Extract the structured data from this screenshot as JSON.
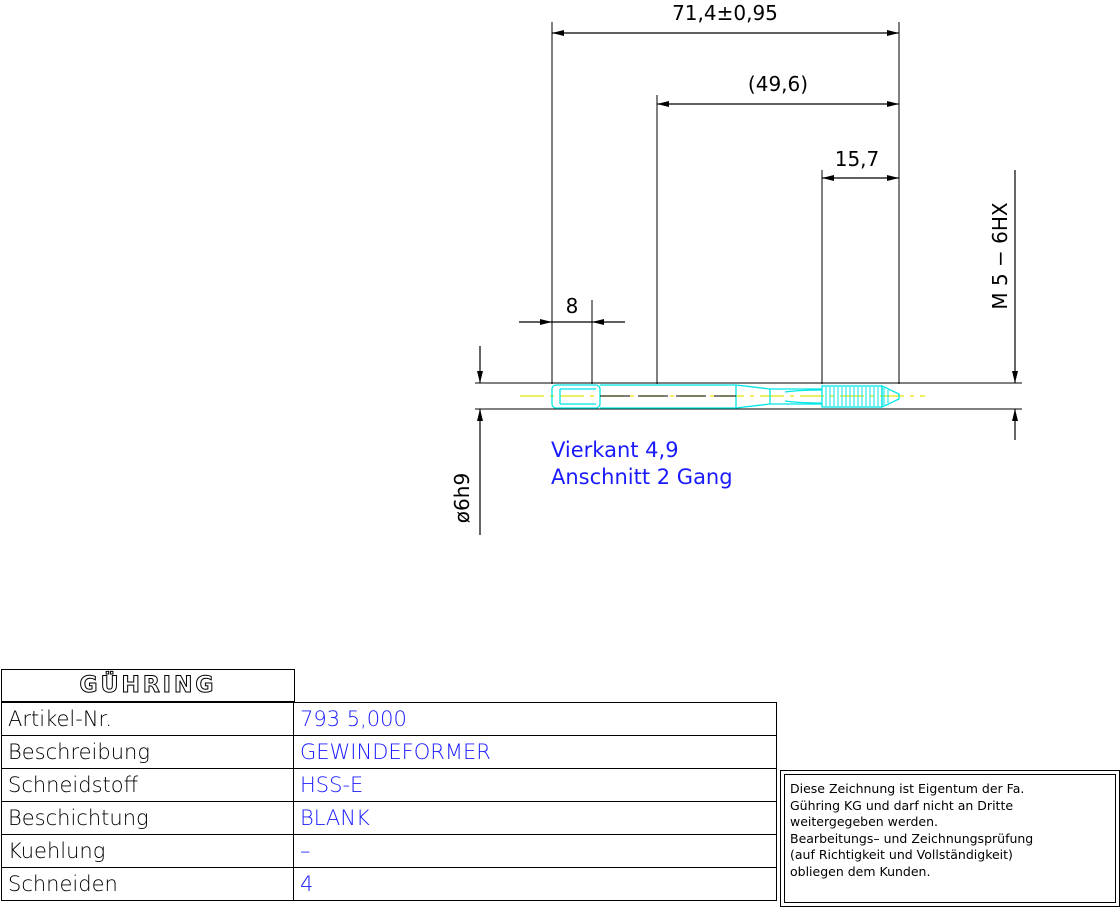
{
  "dimensions": {
    "overall_length": "71,4±0,95",
    "shank_length": "(49,6)",
    "thread_length": "15,7",
    "square_length": "8",
    "thread_spec": "M 5 − 6HX",
    "shank_diameter": "ø6h9"
  },
  "annotations": {
    "line1": "Vierkant 4,9",
    "line2": "Anschnitt 2 Gang"
  },
  "title_block": {
    "logo": "GÜHRING",
    "rows": [
      {
        "label": "Artikel-Nr.",
        "value": "793 5,000"
      },
      {
        "label": "Beschreibung",
        "value": "GEWINDEFORMER"
      },
      {
        "label": "Schneidstoff",
        "value": "HSS-E"
      },
      {
        "label": "Beschichtung",
        "value": "BLANK"
      },
      {
        "label": "Kuehlung",
        "value": "–"
      },
      {
        "label": "Schneiden",
        "value": "4"
      }
    ]
  },
  "notice": {
    "lines": [
      "Diese Zeichnung ist Eigentum der Fa.",
      "Gühring KG und darf nicht an Dritte",
      "weitergegeben werden.",
      "Bearbeitungs– und Zeichnungsprüfung",
      "(auf Richtigkeit und Vollständigkeit)",
      "obliegen dem Kunden."
    ]
  },
  "colors": {
    "outline": "#00e5e5",
    "centerline": "#e5e500",
    "annotation_text": "#1a1aff",
    "dimension": "#000000"
  }
}
